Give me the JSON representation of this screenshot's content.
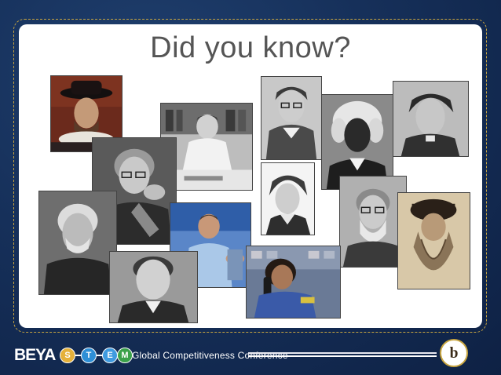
{
  "slide": {
    "title": "Did you know?"
  },
  "footer": {
    "brand": "BEYA",
    "stem_letters": [
      "S",
      "T",
      "E",
      "M"
    ],
    "conference_name": "Global Competitiveness Conference",
    "logo_letter": "b"
  },
  "colors": {
    "background": "#16305a",
    "frame_border": "#c9a640",
    "title": "#555555",
    "stem_s": "#e5b13a",
    "stem_t": "#2e8fd6",
    "stem_e": "#3f9be0",
    "stem_m": "#3aa14a"
  },
  "photos": [
    "portrait-man-hat-ruff",
    "portrait-woman-desk",
    "portrait-woman-glasses-collar",
    "portrait-man-wig",
    "portrait-woman-dark-hair",
    "portrait-woman-hand-chin",
    "portrait-woman-bonnet",
    "portrait-man-white-hair",
    "portrait-man-bearded-glasses",
    "portrait-man-long-beard-hat",
    "portrait-man-color-shirt",
    "portrait-young-man",
    "portrait-woman-astronaut"
  ]
}
